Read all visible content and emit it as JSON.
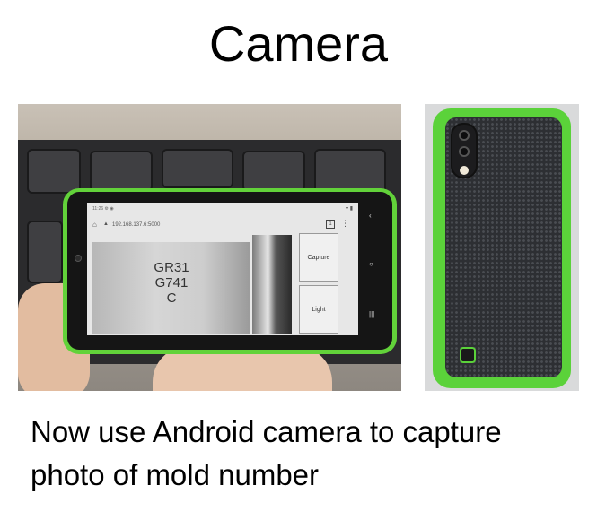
{
  "slide": {
    "title": "Camera",
    "caption": "Now use Android camera to capture photo of mold number"
  },
  "phone_screen": {
    "status_time": "11:26",
    "url": "192.168.137.6:5000",
    "tabs_count": "1",
    "camera_text_lines": [
      "GR31",
      "G741",
      "C"
    ],
    "buttons": {
      "capture_label": "Capture",
      "light_label": "Light"
    }
  },
  "colors": {
    "case_green": "#5bd23a",
    "phone_black": "#151515"
  },
  "icons": {
    "home": "home-icon",
    "lock": "lock-icon",
    "menu": "more-vert-icon",
    "back": "chevron-left-icon",
    "nav_home": "circle-icon",
    "nav_recents": "bars-icon"
  }
}
